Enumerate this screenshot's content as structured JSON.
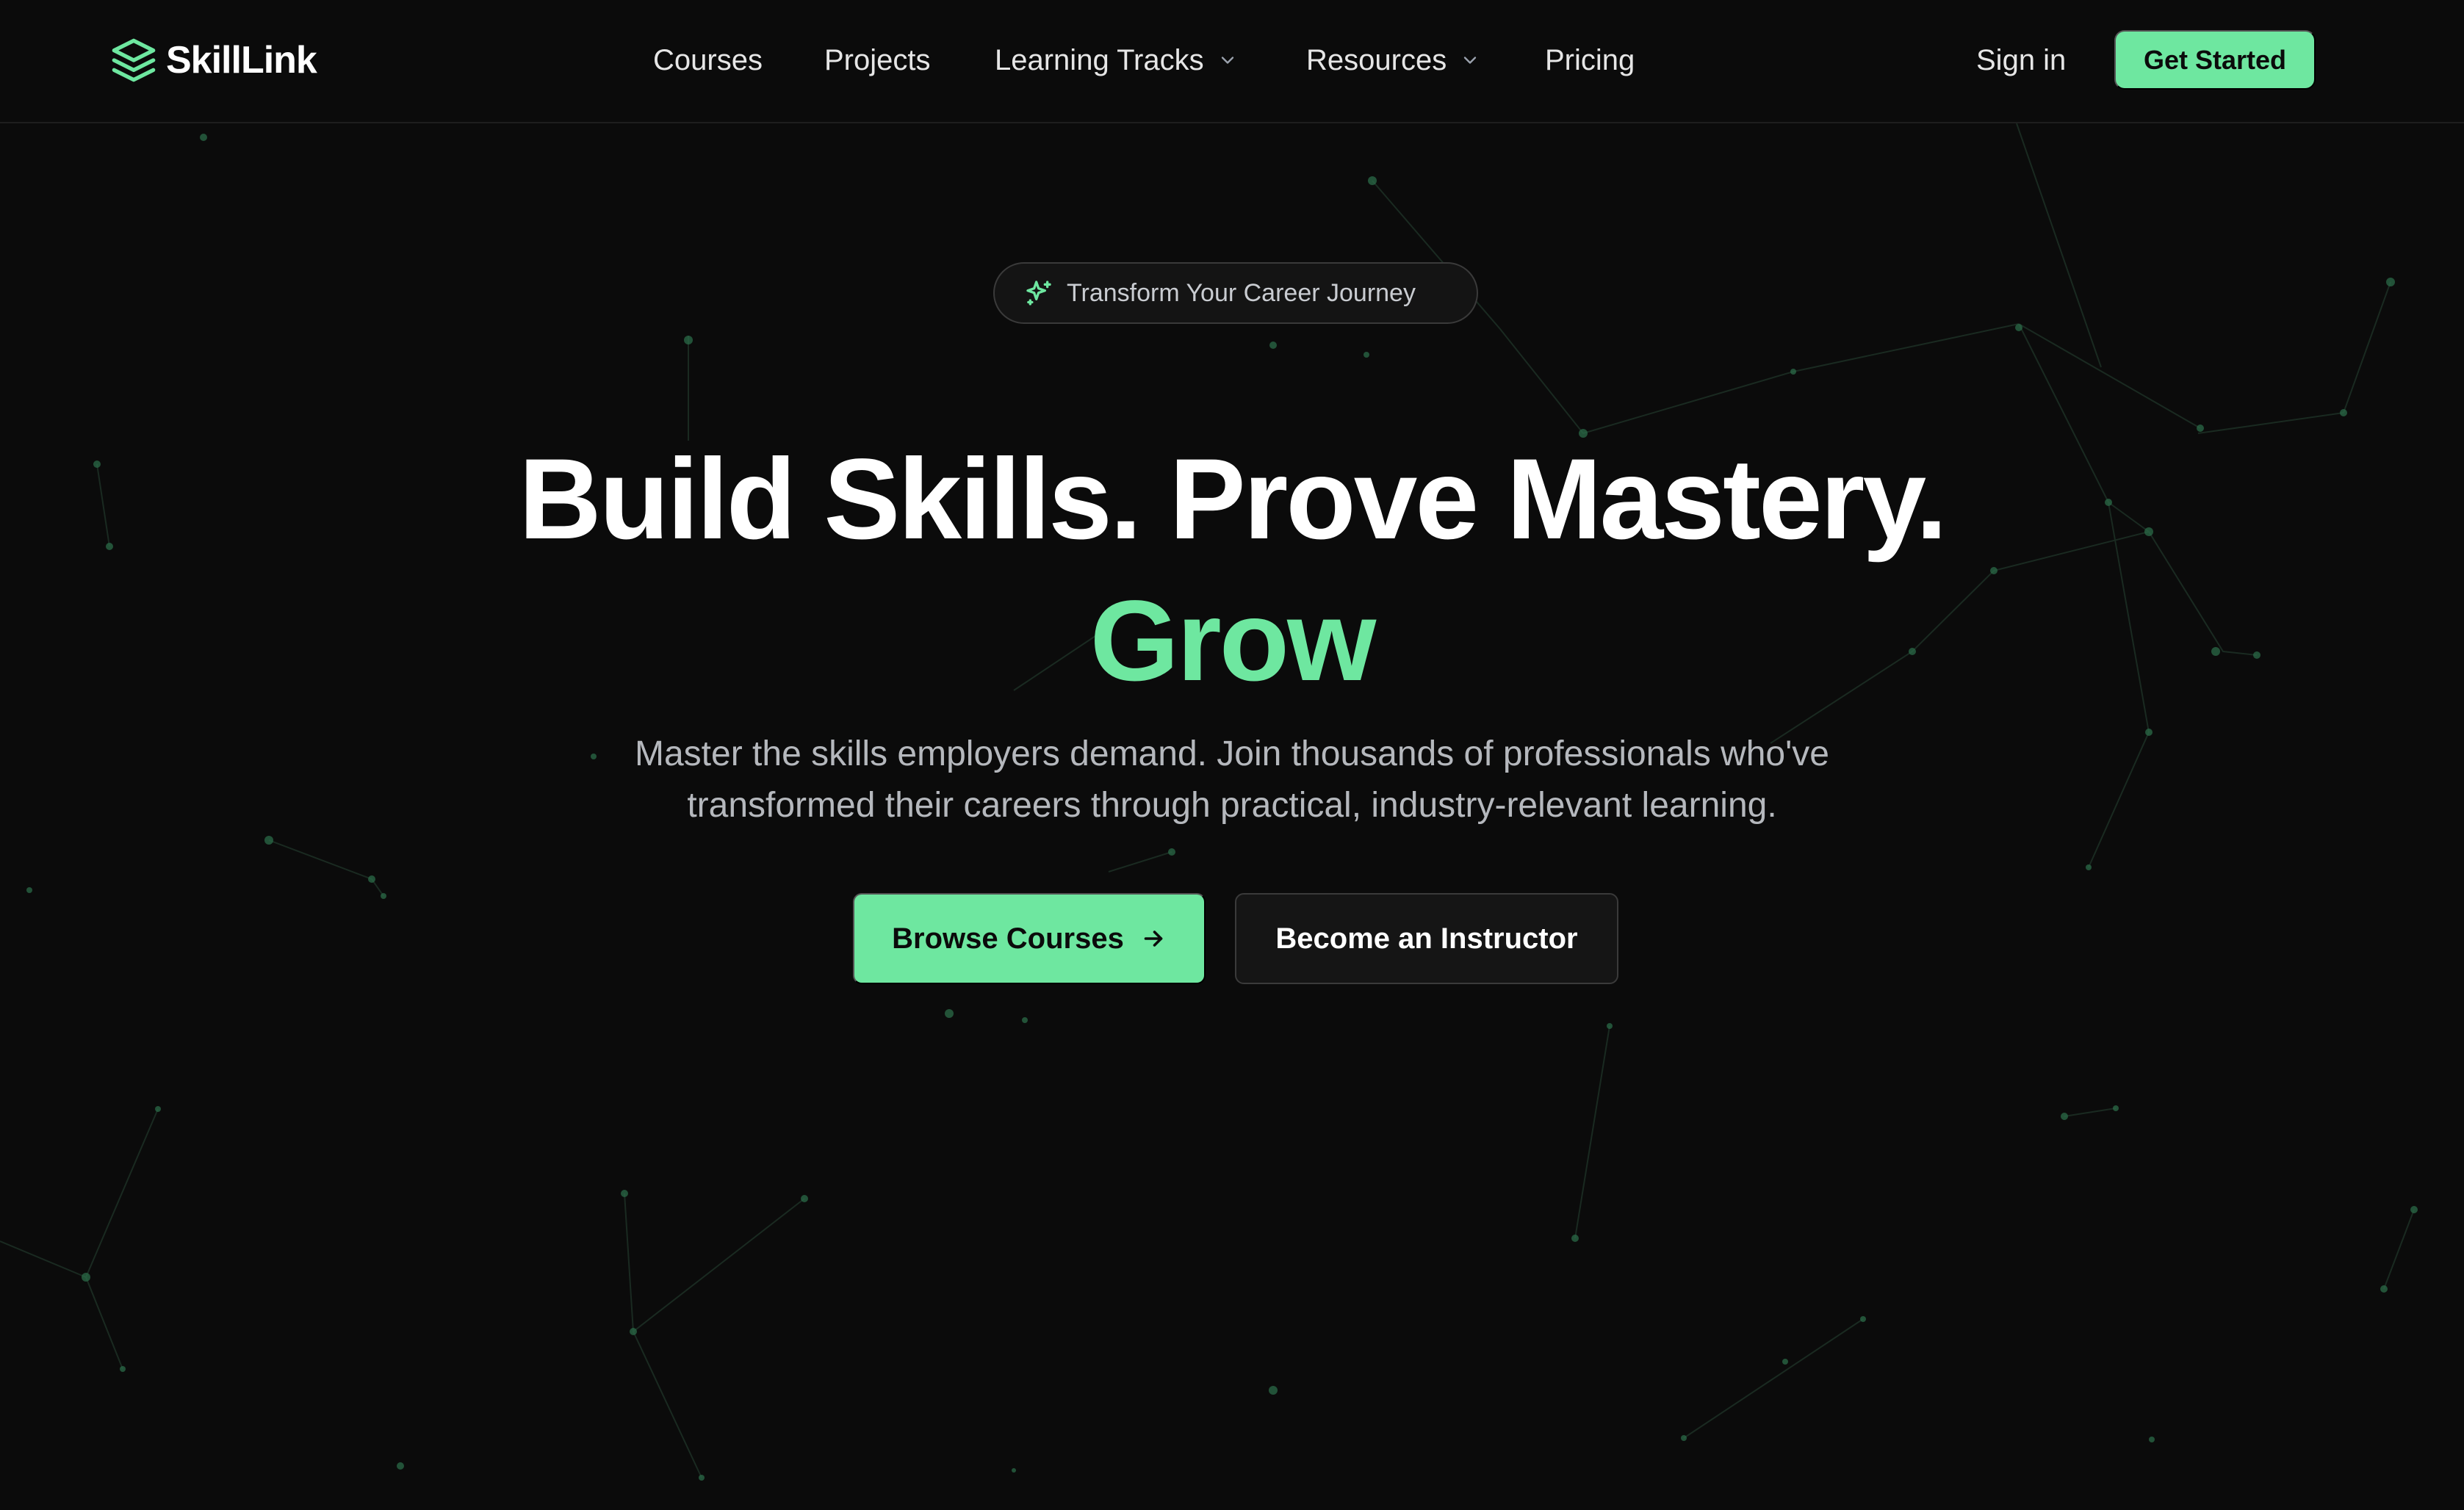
{
  "brand": {
    "name": "SkillLink",
    "icon": "layers-icon"
  },
  "nav": {
    "links": [
      {
        "label": "Courses"
      },
      {
        "label": "Projects"
      },
      {
        "label": "Learning Tracks",
        "dropdown": true
      },
      {
        "label": "Resources",
        "dropdown": true
      },
      {
        "label": "Pricing"
      }
    ],
    "sign_in": "Sign in",
    "get_started": "Get Started"
  },
  "hero": {
    "badge": {
      "icon": "sparkles-icon",
      "text": "Transform Your Career Journey"
    },
    "title": "Build Skills. Prove Mastery.",
    "accent": "Grow",
    "subtitle": "Master the skills employers demand. Join thousands of professionals who've transformed their careers through practical, industry-relevant learning.",
    "primary_cta": "Browse Courses",
    "secondary_cta": "Become an Instructor"
  },
  "colors": {
    "accent": "#6ee7a0",
    "background": "#0b0b0b",
    "nav_text": "#e6e6e6",
    "subtitle_text": "#b5b8bd",
    "border": "#3a3a3a"
  }
}
